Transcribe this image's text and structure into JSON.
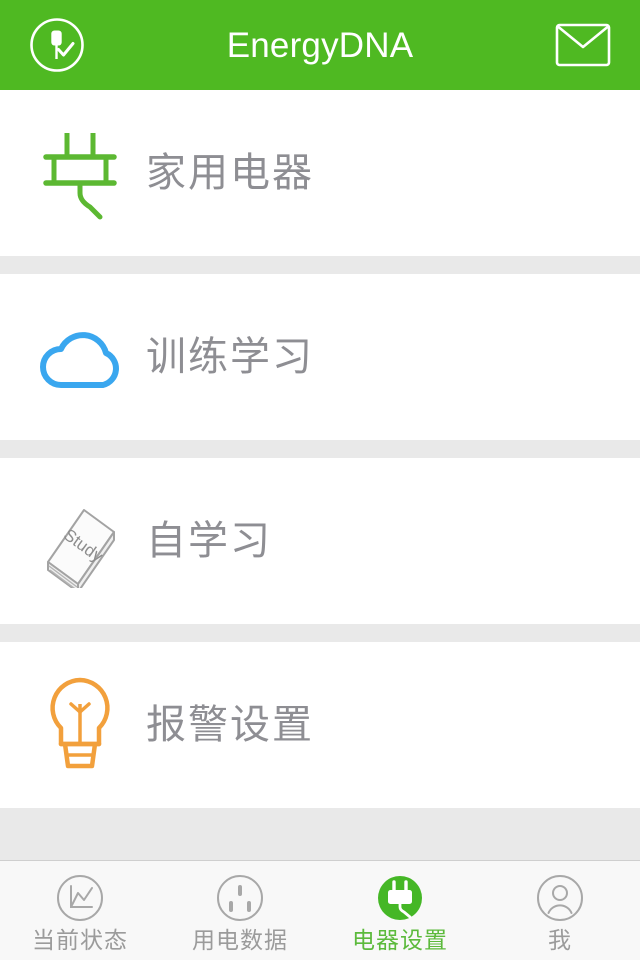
{
  "header": {
    "title": "EnergyDNA",
    "left_icon": "plug-check-circle-icon",
    "right_icon": "envelope-icon",
    "bg_color": "#4fb922",
    "title_color": "#ffffff"
  },
  "main": {
    "items": [
      {
        "label": "家用电器",
        "icon": "plug-icon",
        "icon_color": "#5cb832"
      },
      {
        "label": "训练学习",
        "icon": "cloud-icon",
        "icon_color": "#3aa7ef"
      },
      {
        "label": "自学习",
        "icon": "study-book-icon",
        "icon_color": "#9a9a9a",
        "icon_text": "Study"
      },
      {
        "label": "报警设置",
        "icon": "lightbulb-icon",
        "icon_color": "#f2a03c"
      }
    ],
    "label_color": "#8e8e93",
    "divider_color": "#e9e9e9"
  },
  "tabbar": {
    "active_index": 2,
    "active_color": "#5cba3c",
    "inactive_color": "#9b9b9b",
    "tabs": [
      {
        "label": "当前状态",
        "icon": "chart-circle-icon"
      },
      {
        "label": "用电数据",
        "icon": "socket-circle-icon"
      },
      {
        "label": "电器设置",
        "icon": "plug-filled-circle-icon"
      },
      {
        "label": "我",
        "icon": "person-circle-icon"
      }
    ]
  }
}
